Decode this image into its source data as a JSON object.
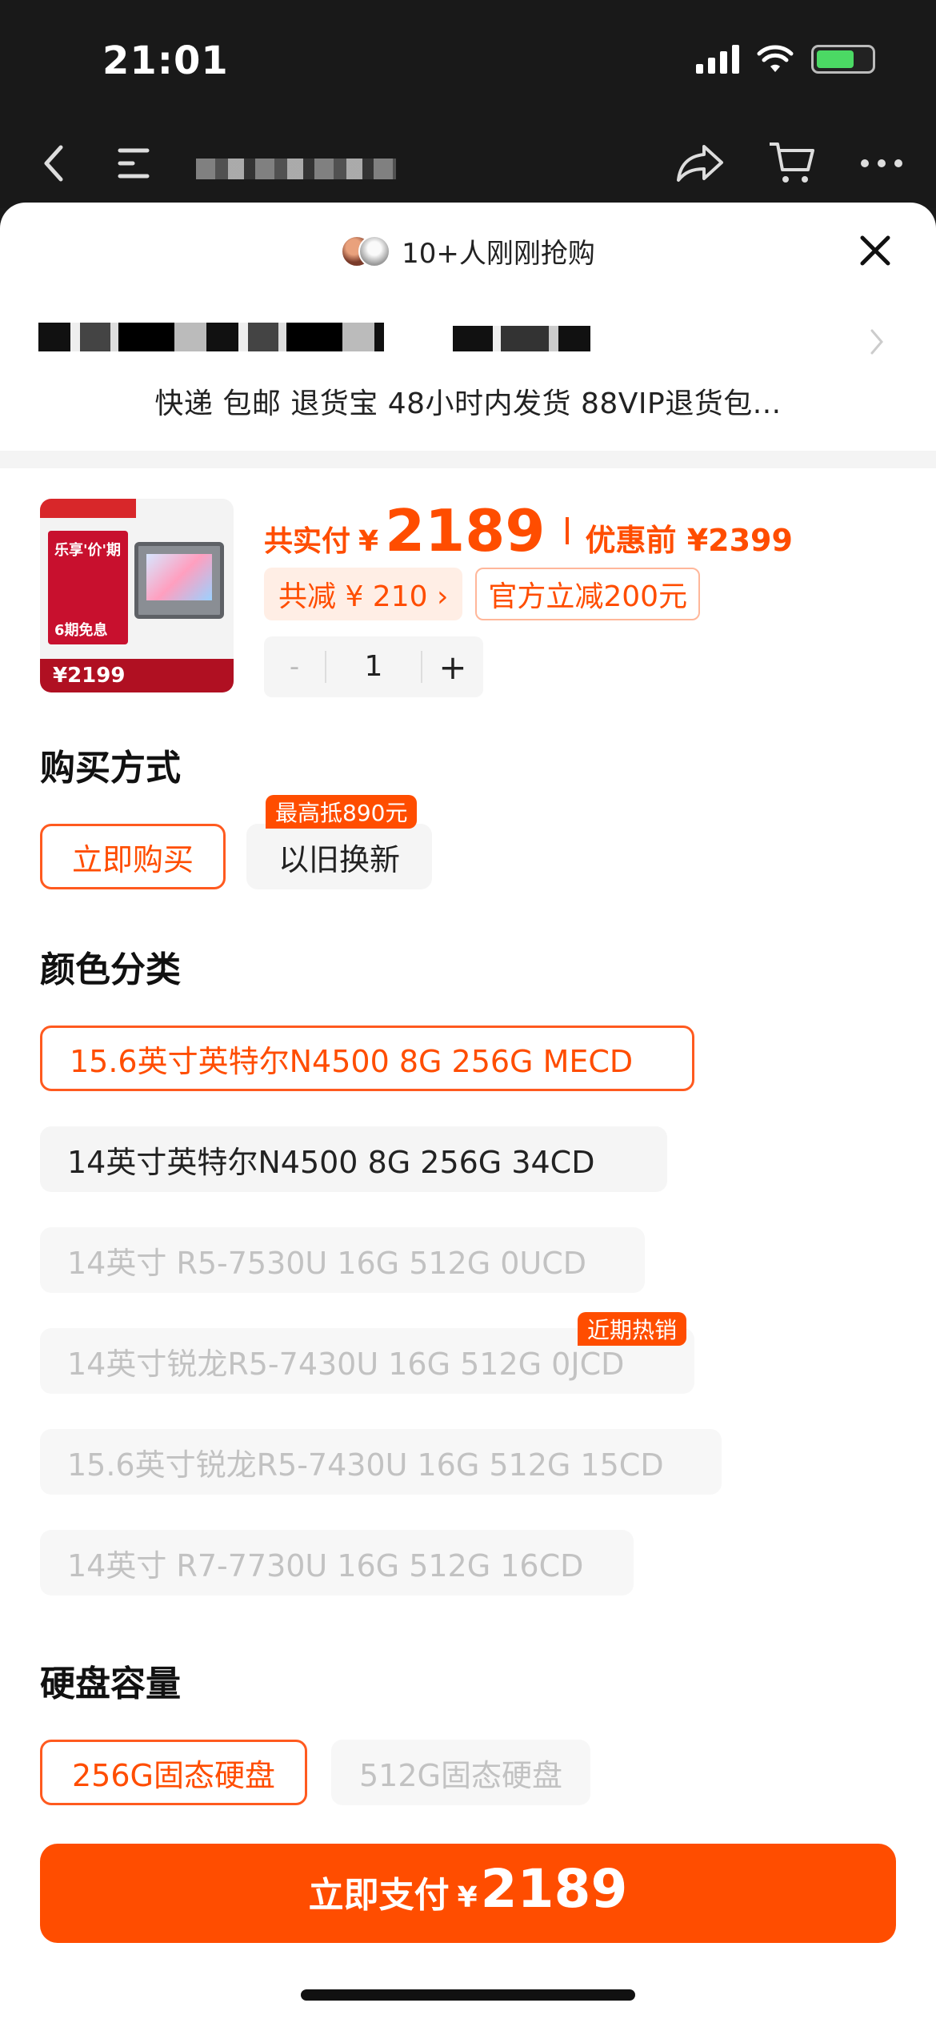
{
  "status_bar": {
    "time": "21:01"
  },
  "sheet": {
    "recent_buyers_text": "10+人刚刚抢购",
    "shipping_info": "快递 包邮 退货宝 48小时内发货 88VIP退货包..."
  },
  "product": {
    "thumbnail": {
      "promo_line1": "乐享'价'期",
      "promo_line2": "6期免息",
      "price_tag": "2199"
    },
    "paid_label": "共实付",
    "currency": "¥",
    "paid_amount": "2189",
    "before_discount": "优惠前 ¥2399",
    "total_saving": "共减 ¥ 210 ›",
    "official_discount": "官方立减200元",
    "quantity": {
      "minus": "-",
      "value": "1",
      "plus": "+"
    }
  },
  "purchase_method": {
    "title": "购买方式",
    "options": [
      {
        "label": "立即购买",
        "state": "selected"
      },
      {
        "label": "以旧换新",
        "state": "normal",
        "badge": "最高抵890元"
      }
    ]
  },
  "color_category": {
    "title": "颜色分类",
    "options": [
      {
        "label": "15.6英寸英特尔N4500 8G 256G   MECD",
        "state": "selected"
      },
      {
        "label": "14英寸英特尔N4500 8G 256G    34CD",
        "state": "normal"
      },
      {
        "label": "14英寸 R5-7530U  16G  512G  0UCD",
        "state": "disabled"
      },
      {
        "label": "14英寸锐龙R5-7430U  16G 512G   0JCD",
        "state": "disabled",
        "badge": "近期热销"
      },
      {
        "label": "15.6英寸锐龙R5-7430U  16G  512G  15CD",
        "state": "disabled"
      },
      {
        "label": "14英寸 R7-7730U  16G  512G  16CD",
        "state": "disabled"
      }
    ]
  },
  "storage": {
    "title": "硬盘容量",
    "options": [
      {
        "label": "256G固态硬盘",
        "state": "selected"
      },
      {
        "label": "512G固态硬盘",
        "state": "disabled"
      }
    ]
  },
  "pay_button": {
    "label": "立即支付",
    "currency": "¥",
    "amount": "2189"
  },
  "colors": {
    "accent": "#ff4d00",
    "selected_border": "#ff5a1f",
    "disabled_text": "#c2c2c2"
  }
}
